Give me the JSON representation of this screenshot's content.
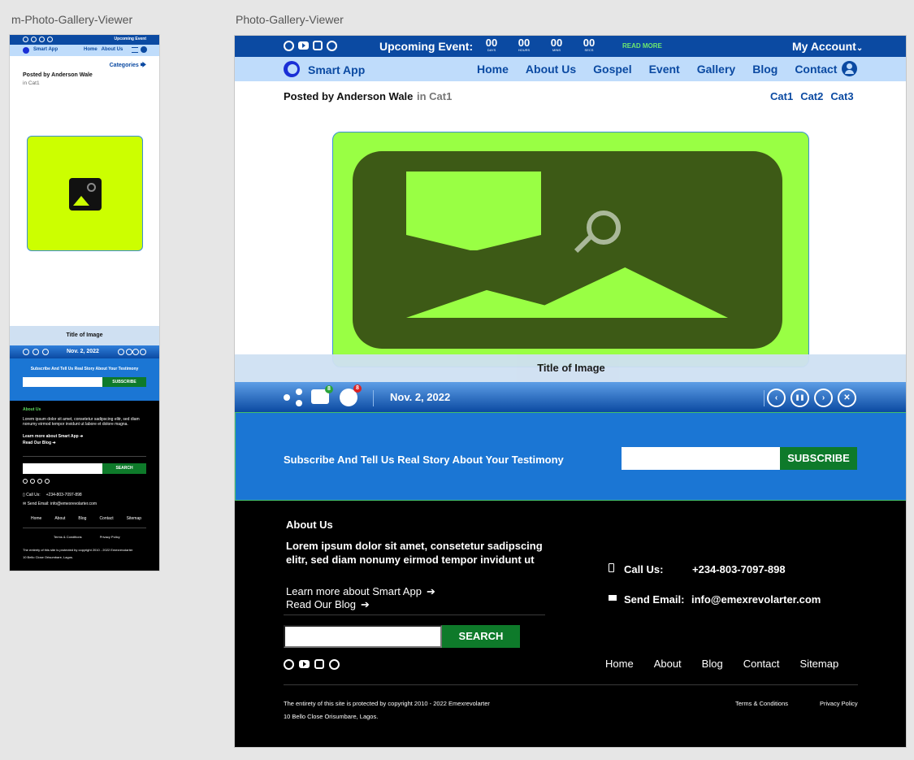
{
  "labels": {
    "mobile_artboard": "m-Photo-Gallery-Viewer",
    "desktop_artboard": "Photo-Gallery-Viewer"
  },
  "topbar": {
    "event_label": "Upcoming Event:",
    "mobile_event_label": "Upcoming Event",
    "countdown": [
      {
        "value": "00",
        "unit": "DAYS"
      },
      {
        "value": "00",
        "unit": "HOURS"
      },
      {
        "value": "00",
        "unit": "MINS"
      },
      {
        "value": "00",
        "unit": "SECS"
      }
    ],
    "read_more": "READ MORE",
    "account": "My Account",
    "account_caret": "⌄",
    "social_icons": [
      "facebook-icon",
      "youtube-icon",
      "instagram-icon",
      "whatsapp-icon"
    ]
  },
  "nav": {
    "brand": "Smart App",
    "items": [
      "Home",
      "About Us",
      "Gospel",
      "Event",
      "Gallery",
      "Blog",
      "Contact"
    ],
    "mobile_items": [
      "Home",
      "About Us"
    ]
  },
  "post": {
    "posted_by": "Posted by Anderson Wale",
    "in_cat": "in Cat1",
    "categories": [
      "Cat1",
      "Cat2",
      "Cat3"
    ],
    "mobile_categories": "Categories",
    "mobile_categories_arrow": "🡆"
  },
  "viewer": {
    "image_title": "Title of Image",
    "date": "Nov. 2, 2022",
    "comment_count": "8",
    "reaction_count": "8",
    "controls": {
      "prev": "‹",
      "pause": "❚❚",
      "next": "›",
      "close": "✕"
    }
  },
  "subscribe": {
    "text": "Subscribe And Tell Us Real Story About Your Testimony",
    "button": "SUBSCRIBE"
  },
  "footer": {
    "about_heading": "About Us",
    "lorem": "Lorem ipsum dolor sit amet, consetetur sadipscing elitr, sed diam nonumy eirmod tempor invidunt ut",
    "mobile_lorem": "Lorem ipsum dolor sit amet, consetetur sadipscing elitr, sed diam nonumy eirmod tempor invidunt ut labore et dolore magna.",
    "link_learn": "Learn more about Smart App",
    "link_blog": "Read Our Blog",
    "arrow": "➔",
    "search_button": "SEARCH",
    "call_label": "Call Us:",
    "phone": "+234-803-7097-898",
    "email_label": "Send Email:",
    "email": "info@emexrevolarter.com",
    "nav": [
      "Home",
      "About",
      "Blog",
      "Contact",
      "Sitemap"
    ],
    "copyright": "The entirety of this site is protected by copyright  2010 - 2022 Emexrevolarter",
    "address": "10 Bello Close Orisumbare, Lagos.",
    "terms": "Terms & Conditions",
    "privacy": "Privacy Policy"
  }
}
